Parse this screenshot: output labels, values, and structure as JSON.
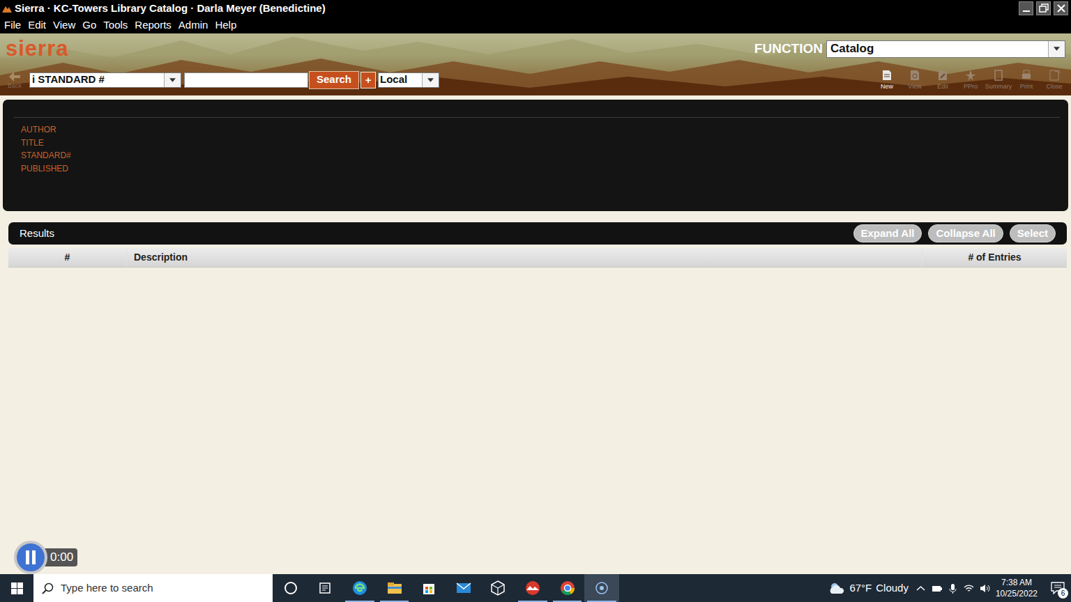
{
  "window": {
    "title": "Sierra · KC-Towers Library Catalog · Darla Meyer (Benedictine)"
  },
  "menu": [
    "File",
    "Edit",
    "View",
    "Go",
    "Tools",
    "Reports",
    "Admin",
    "Help"
  ],
  "header": {
    "logo": "sierra",
    "function_label": "FUNCTION",
    "function_value": "Catalog"
  },
  "toolbar": {
    "back": {
      "label": "Back",
      "disabled": true
    },
    "search_type": "i STANDARD #",
    "search_value": "",
    "search_button": "Search",
    "add_button": "+",
    "scope": "Local",
    "actions": [
      {
        "label": "New",
        "disabled": false
      },
      {
        "label": "View",
        "disabled": true
      },
      {
        "label": "Edit",
        "disabled": true
      },
      {
        "label": "PPro",
        "disabled": true
      },
      {
        "label": "Summary",
        "disabled": true
      },
      {
        "label": "Print",
        "disabled": true
      },
      {
        "label": "Close",
        "disabled": true
      }
    ]
  },
  "record_fields": [
    "AUTHOR",
    "TITLE",
    "STANDARD#",
    "PUBLISHED"
  ],
  "results": {
    "title": "Results",
    "buttons": [
      {
        "label": "Expand All",
        "disabled": true
      },
      {
        "label": "Collapse All",
        "disabled": true
      },
      {
        "label": "Select",
        "disabled": true
      }
    ],
    "columns": [
      "#",
      "Description",
      "# of Entries"
    ],
    "rows": []
  },
  "recorder": {
    "time": "0:00"
  },
  "taskbar": {
    "search_placeholder": "Type here to search",
    "apps": [
      {
        "kind": "cortana",
        "open": false,
        "selected": false
      },
      {
        "kind": "taskview",
        "open": false,
        "selected": false
      },
      {
        "kind": "edge",
        "open": true,
        "selected": false
      },
      {
        "kind": "explorer",
        "open": true,
        "selected": false
      },
      {
        "kind": "store",
        "open": false,
        "selected": false
      },
      {
        "kind": "mail",
        "open": false,
        "selected": false
      },
      {
        "kind": "cube",
        "open": false,
        "selected": false
      },
      {
        "kind": "sierra",
        "open": true,
        "selected": false
      },
      {
        "kind": "chrome",
        "open": true,
        "selected": false
      },
      {
        "kind": "recorder",
        "open": true,
        "selected": true
      }
    ],
    "weather": {
      "temp": "67°F",
      "condition": "Cloudy"
    },
    "time": "7:38 AM",
    "date": "10/25/2022",
    "notifications": "6"
  }
}
